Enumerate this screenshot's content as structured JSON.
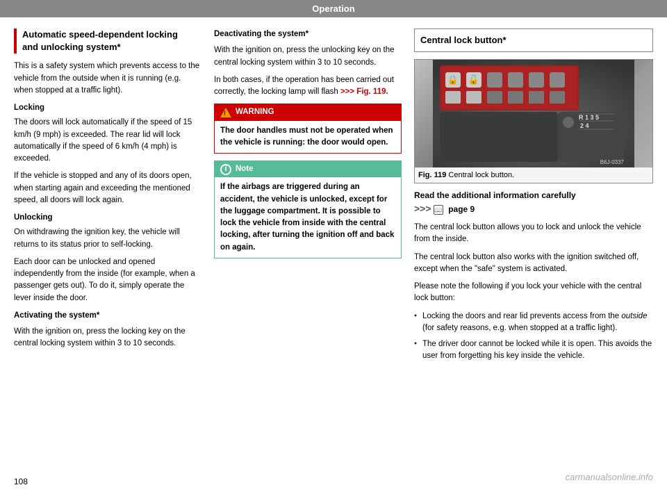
{
  "header": {
    "label": "Operation"
  },
  "left_column": {
    "box_title_line1": "Automatic speed-dependent locking",
    "box_title_line2": "and unlocking system*",
    "intro": "This is a safety system which prevents access to the vehicle from the outside when it is running (e.g. when stopped at a traffic light).",
    "locking_heading": "Locking",
    "locking_text": "The doors will lock automatically if the speed of 15 km/h (9 mph) is exceeded. The rear lid will lock automatically if the speed of 6 km/h (4 mph) is exceeded.",
    "locking_text2": "If the vehicle is stopped and any of its doors open, when starting again and exceeding the mentioned speed, all doors will lock again.",
    "unlocking_heading": "Unlocking",
    "unlocking_text": "On withdrawing the ignition key, the vehicle will returns to its status prior to self-locking.",
    "unlocking_text2": "Each door can be unlocked and opened independently from the inside (for example, when a passenger gets out). To do it, simply operate the lever inside the door.",
    "activating_heading": "Activating the system*",
    "activating_text": "With the ignition on, press the locking key on the central locking system within 3 to 10 seconds."
  },
  "mid_column": {
    "deactivating_heading": "Deactivating the system*",
    "deactivating_text1": "With the ignition on, press the unlocking key on the central locking system within 3 to 10 seconds.",
    "deactivating_text2": "In both cases, if the operation has been carried out correctly, the locking lamp will flash",
    "fig_ref_inline": ">>> Fig. 119.",
    "warning_header": "WARNING",
    "warning_body": "The door handles must not be operated when the vehicle is running: the door would open.",
    "note_header": "Note",
    "note_body": "If the airbags are triggered during an accident, the vehicle is unlocked, except for the luggage compartment. It is possible to lock the vehicle from inside with the central locking, after turning the ignition off and back on again."
  },
  "right_column": {
    "box_title": "Central lock button*",
    "fig_caption_num": "Fig. 119",
    "fig_caption_text": "Central lock button.",
    "fig_ref_code": "B6J-0337",
    "read_more_line1": "Read the additional information carefully",
    "read_more_line2": ">>>",
    "read_more_page": "page 9",
    "text1": "The central lock button allows you to lock and unlock the vehicle from the inside.",
    "text2": "The central lock button also works with the ignition switched off, except when the \"safe\" system is activated.",
    "text3": "Please note the following if you lock your vehicle with the central lock button:",
    "bullet1_text": "Locking the doors and rear lid prevents access from the",
    "bullet1_italic": "outside",
    "bullet1_rest": "(for safety reasons, e.g. when stopped at a traffic light).",
    "bullet2": "The driver door cannot be locked while it is open. This avoids the user from forgetting his key inside the vehicle."
  },
  "footer": {
    "page_number": "108",
    "watermark": "carmanualsonline.info"
  }
}
